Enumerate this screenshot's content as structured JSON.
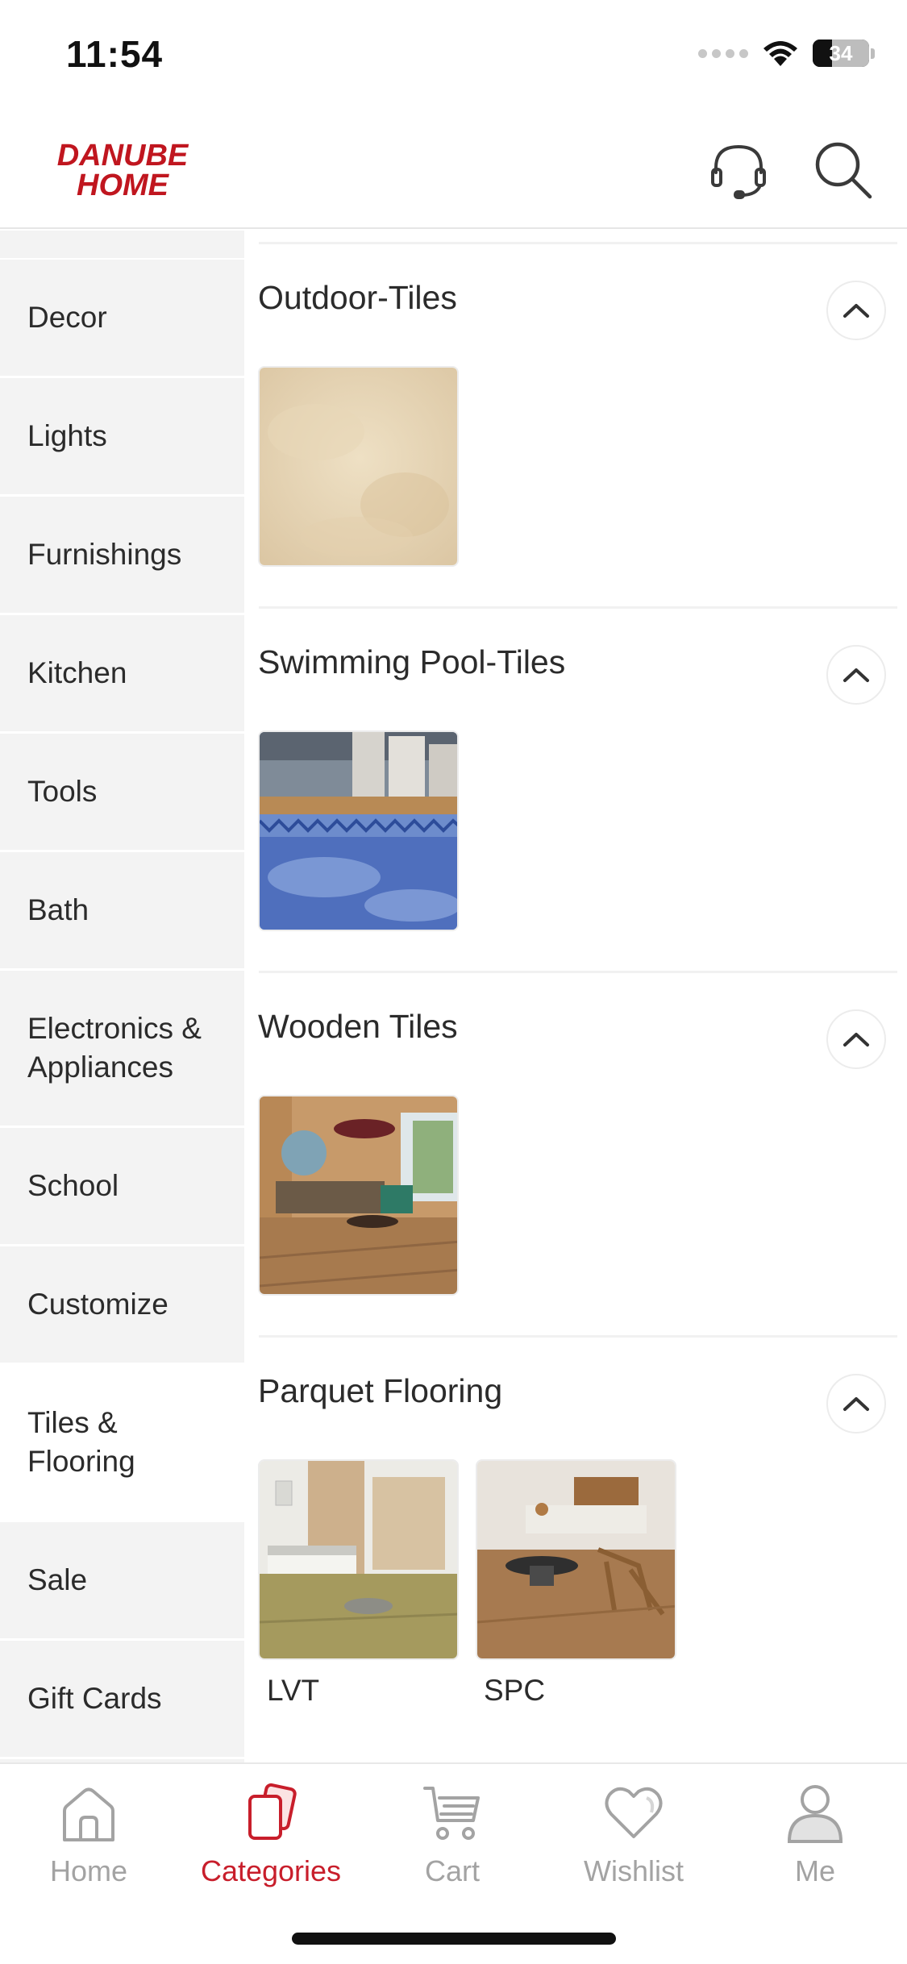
{
  "status": {
    "time": "11:54",
    "battery": "34"
  },
  "header": {
    "logo_line1": "DANUBE",
    "logo_line2": "HOME",
    "brand_color": "#c0161f",
    "icons": [
      "headset-icon",
      "search-icon"
    ]
  },
  "sidebar": {
    "items": [
      {
        "label": "Decor"
      },
      {
        "label": "Lights"
      },
      {
        "label": "Furnishings"
      },
      {
        "label": "Kitchen"
      },
      {
        "label": "Tools"
      },
      {
        "label": "Bath"
      },
      {
        "label": "Electronics & Appliances"
      },
      {
        "label": "School"
      },
      {
        "label": "Customize"
      },
      {
        "label": "Tiles & Flooring"
      },
      {
        "label": "Sale"
      },
      {
        "label": "Gift Cards"
      }
    ],
    "selected": "Tiles & Flooring"
  },
  "sections": [
    {
      "title": "Outdoor-Tiles",
      "items": [
        {
          "label": ""
        }
      ]
    },
    {
      "title": "Swimming Pool-Tiles",
      "items": [
        {
          "label": ""
        }
      ]
    },
    {
      "title": "Wooden Tiles",
      "items": [
        {
          "label": ""
        }
      ]
    },
    {
      "title": "Parquet Flooring",
      "items": [
        {
          "label": "LVT"
        },
        {
          "label": "SPC"
        }
      ]
    }
  ],
  "bottom_nav": {
    "items": [
      {
        "label": "Home",
        "icon": "home-icon"
      },
      {
        "label": "Categories",
        "icon": "categories-icon"
      },
      {
        "label": "Cart",
        "icon": "cart-icon"
      },
      {
        "label": "Wishlist",
        "icon": "heart-icon"
      },
      {
        "label": "Me",
        "icon": "user-icon"
      }
    ],
    "active": "Categories",
    "active_color": "#c81e2b",
    "inactive_color": "#a3a3a3"
  }
}
